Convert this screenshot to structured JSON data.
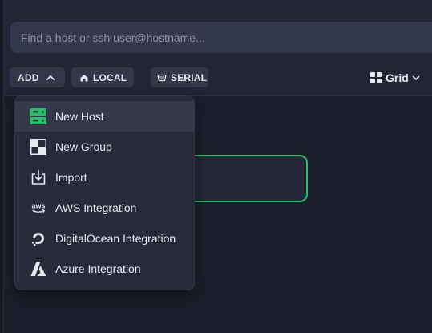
{
  "search": {
    "placeholder": "Find a host or ssh user@hostname..."
  },
  "toolbar": {
    "add_label": "ADD",
    "local_label": "LOCAL",
    "serial_label": "SERIAL",
    "view_label": "Grid"
  },
  "menu": {
    "items": [
      {
        "label": "New Host",
        "icon": "server-icon"
      },
      {
        "label": "New Group",
        "icon": "group-icon"
      },
      {
        "label": "Import",
        "icon": "import-icon"
      },
      {
        "label": "AWS Integration",
        "icon": "aws-icon",
        "icon_text": "aws"
      },
      {
        "label": "DigitalOcean Integration",
        "icon": "digitalocean-icon"
      },
      {
        "label": "Azure Integration",
        "icon": "azure-icon"
      }
    ]
  },
  "colors": {
    "background": "#1c1f2b",
    "topbar": "#222533",
    "button": "#33374a",
    "menu": "#272a39",
    "accent_green": "#23c16b"
  }
}
